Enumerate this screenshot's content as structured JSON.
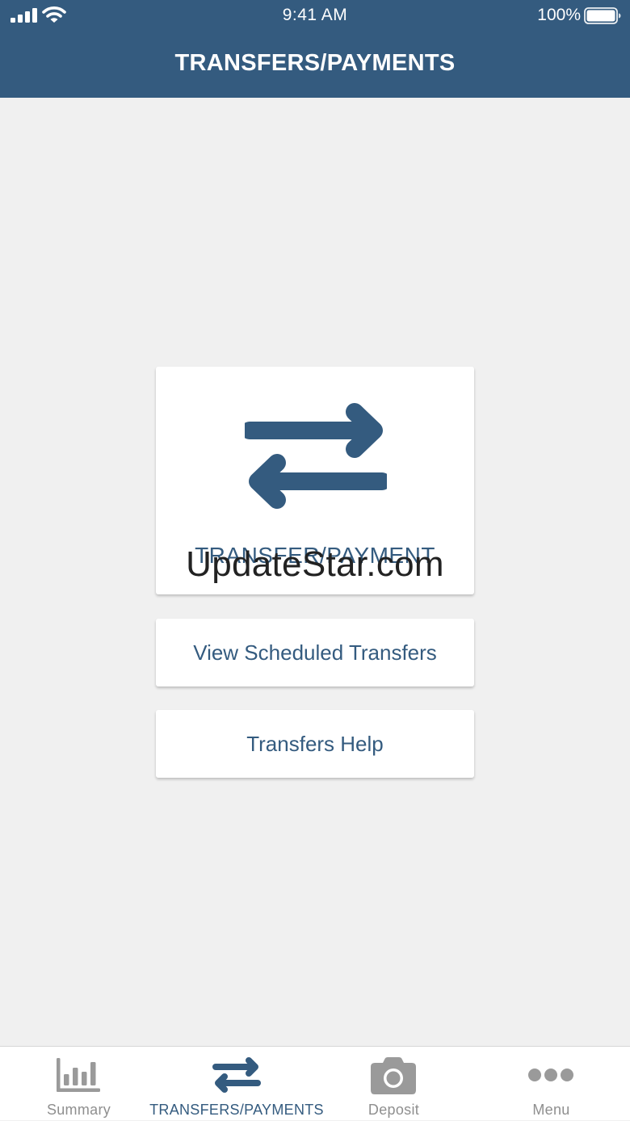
{
  "status_bar": {
    "time": "9:41 AM",
    "battery": "100%",
    "icons": [
      "signal-icon",
      "wifi-icon",
      "battery-icon"
    ]
  },
  "header": {
    "title": "TRANSFERS/PAYMENTS"
  },
  "main": {
    "transfer_card": {
      "icon": "transfer-arrows-icon",
      "label": "TRANSFER/PAYMENT"
    },
    "watermark": "UpdateStar.com",
    "scheduled_button": "View Scheduled Transfers",
    "help_button": "Transfers Help"
  },
  "tabbar": {
    "tabs": [
      {
        "label": "Summary",
        "icon": "bar-chart-icon",
        "active": false
      },
      {
        "label": "TRANSFERS/PAYMENTS",
        "icon": "transfer-arrows-icon",
        "active": true
      },
      {
        "label": "Deposit",
        "icon": "camera-icon",
        "active": false
      },
      {
        "label": "Menu",
        "icon": "more-dots-icon",
        "active": false
      }
    ]
  },
  "colors": {
    "brand": "#345b7f",
    "background": "#f0f0f0",
    "inactive_tab": "#8f8f8f"
  }
}
